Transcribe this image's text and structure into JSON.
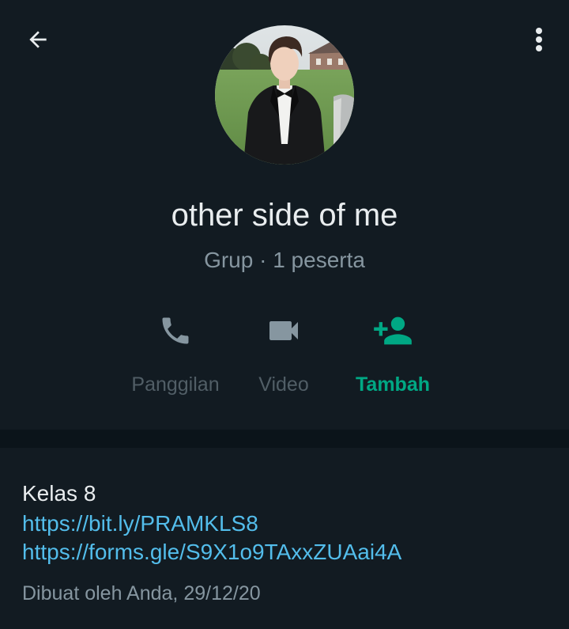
{
  "header": {
    "back_icon": "arrow-left-icon",
    "menu_icon": "more-vertical-icon",
    "group_name": "other side of me",
    "group_meta": "Grup · 1 peserta"
  },
  "actions": [
    {
      "label": "Panggilan",
      "icon": "phone-icon",
      "state": "disabled"
    },
    {
      "label": "Video",
      "icon": "videocam-icon",
      "state": "disabled"
    },
    {
      "label": "Tambah",
      "icon": "add-person-icon",
      "state": "active"
    }
  ],
  "description": {
    "title": "Kelas 8",
    "links": [
      "https://bit.ly/PRAMKLS8",
      "https://forms.gle/S9X1o9TAxxZUAai4A"
    ],
    "created_by": "Dibuat oleh Anda, 29/12/20"
  },
  "colors": {
    "background": "#121b22",
    "accent": "#00a884",
    "link": "#53bdeb",
    "muted": "#515e66",
    "secondary_text": "#8696a0"
  }
}
